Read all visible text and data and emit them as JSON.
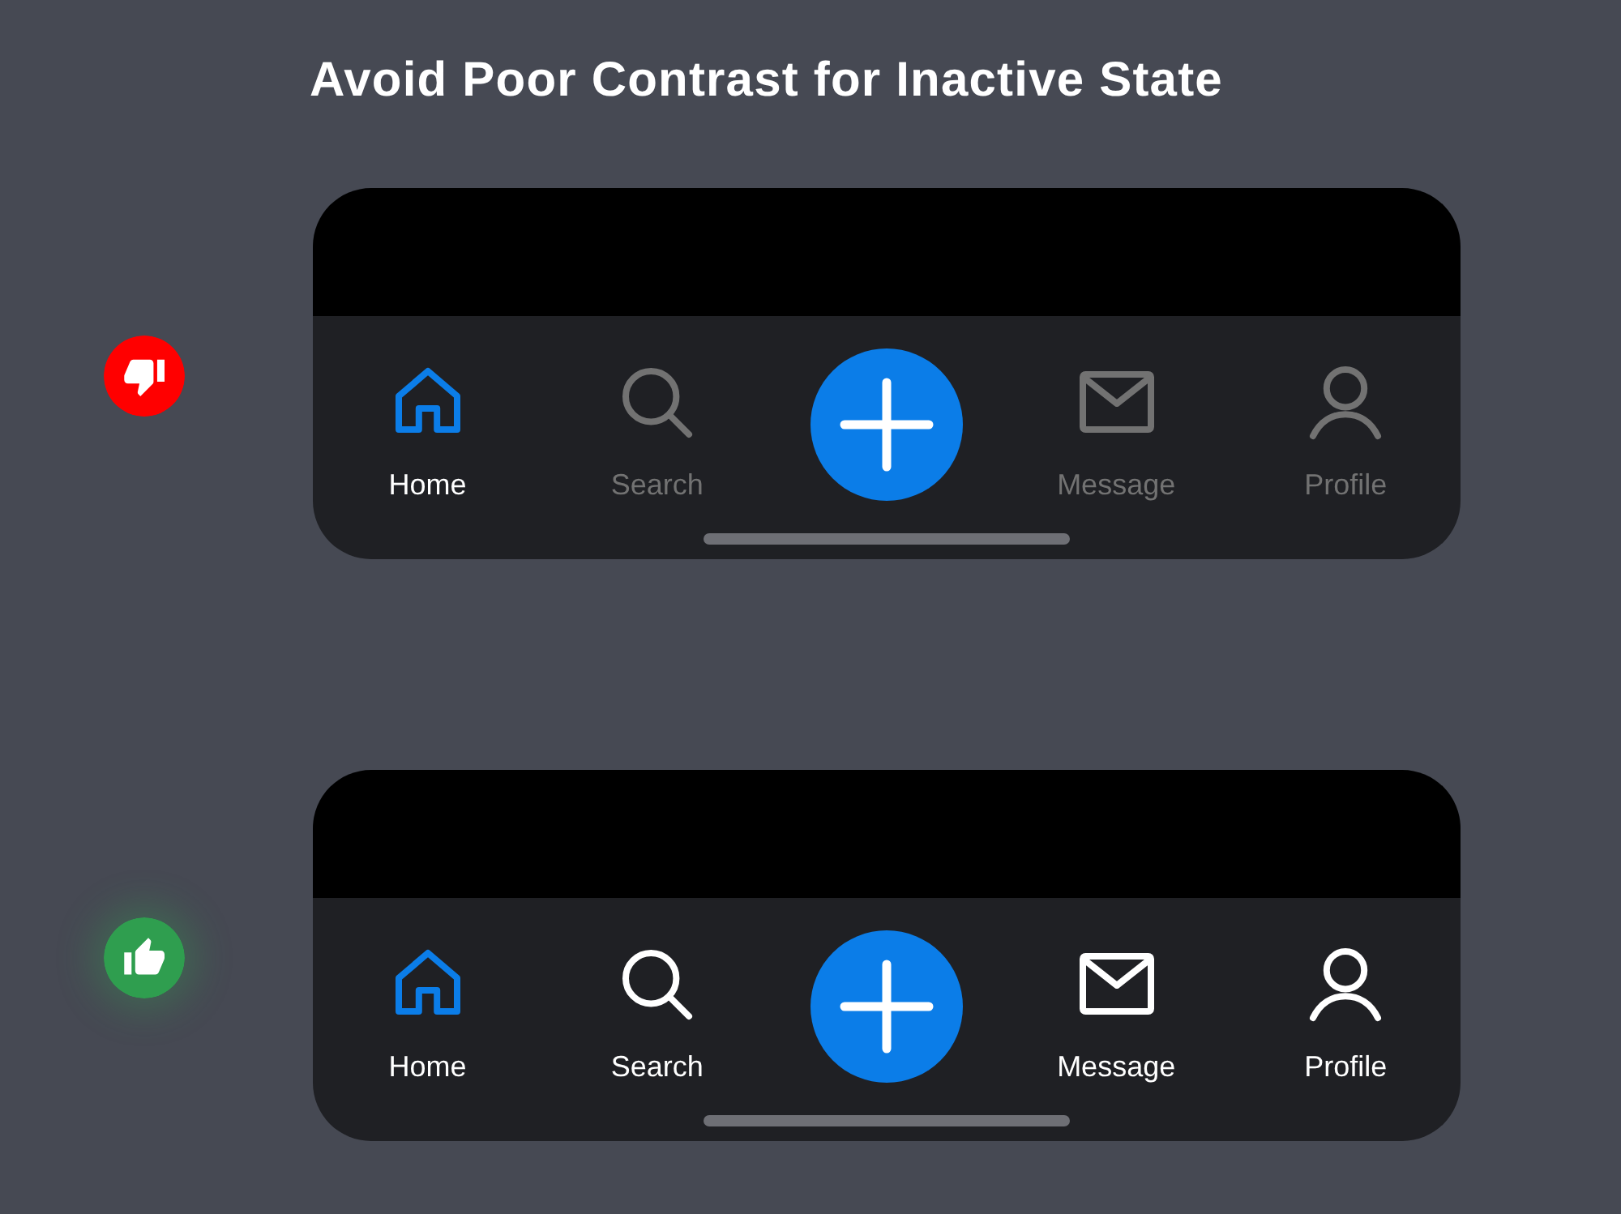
{
  "title": "Avoid Poor Contrast for Inactive State",
  "examples": [
    {
      "approved": false,
      "low_contrast": true,
      "add_button": true,
      "tabs": [
        {
          "kind": "home",
          "label": "Home",
          "selected": true
        },
        {
          "kind": "search",
          "label": "Search",
          "selected": false
        },
        {
          "kind": "message",
          "label": "Message",
          "selected": false
        },
        {
          "kind": "profile",
          "label": "Profile",
          "selected": false
        }
      ]
    },
    {
      "approved": true,
      "low_contrast": false,
      "add_button": true,
      "tabs": [
        {
          "kind": "home",
          "label": "Home",
          "selected": true
        },
        {
          "kind": "search",
          "label": "Search",
          "selected": false
        },
        {
          "kind": "message",
          "label": "Message",
          "selected": false
        },
        {
          "kind": "profile",
          "label": "Profile",
          "selected": false
        }
      ]
    }
  ]
}
